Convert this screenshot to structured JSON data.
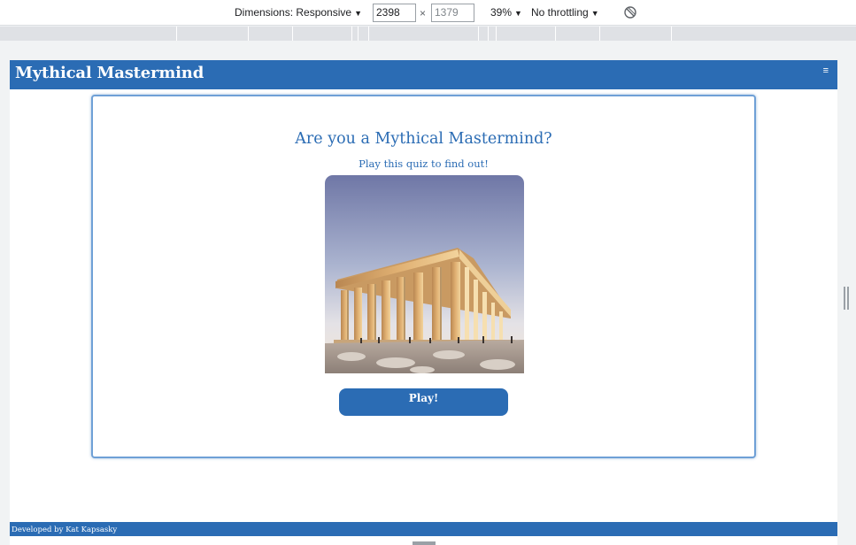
{
  "devtools": {
    "dimensions_label": "Dimensions: Responsive",
    "width_value": "2398",
    "times": "×",
    "height_placeholder": "1379",
    "zoom": "39%",
    "throttling": "No throttling",
    "caret": "▼"
  },
  "site": {
    "brand": "Mythical Mastermind",
    "menu_glyph": "≡",
    "heading": "Are you a Mythical Mastermind?",
    "subheading": "Play this quiz to find out!",
    "play_label": "Play!",
    "footer": "Developed by Kat Kapsasky"
  },
  "colors": {
    "primary": "#2b6cb4",
    "card_border": "#6fa0d6"
  },
  "icons": {
    "rotate": "rotate-icon",
    "menu": "hamburger-icon",
    "hero": "parthenon-image"
  }
}
